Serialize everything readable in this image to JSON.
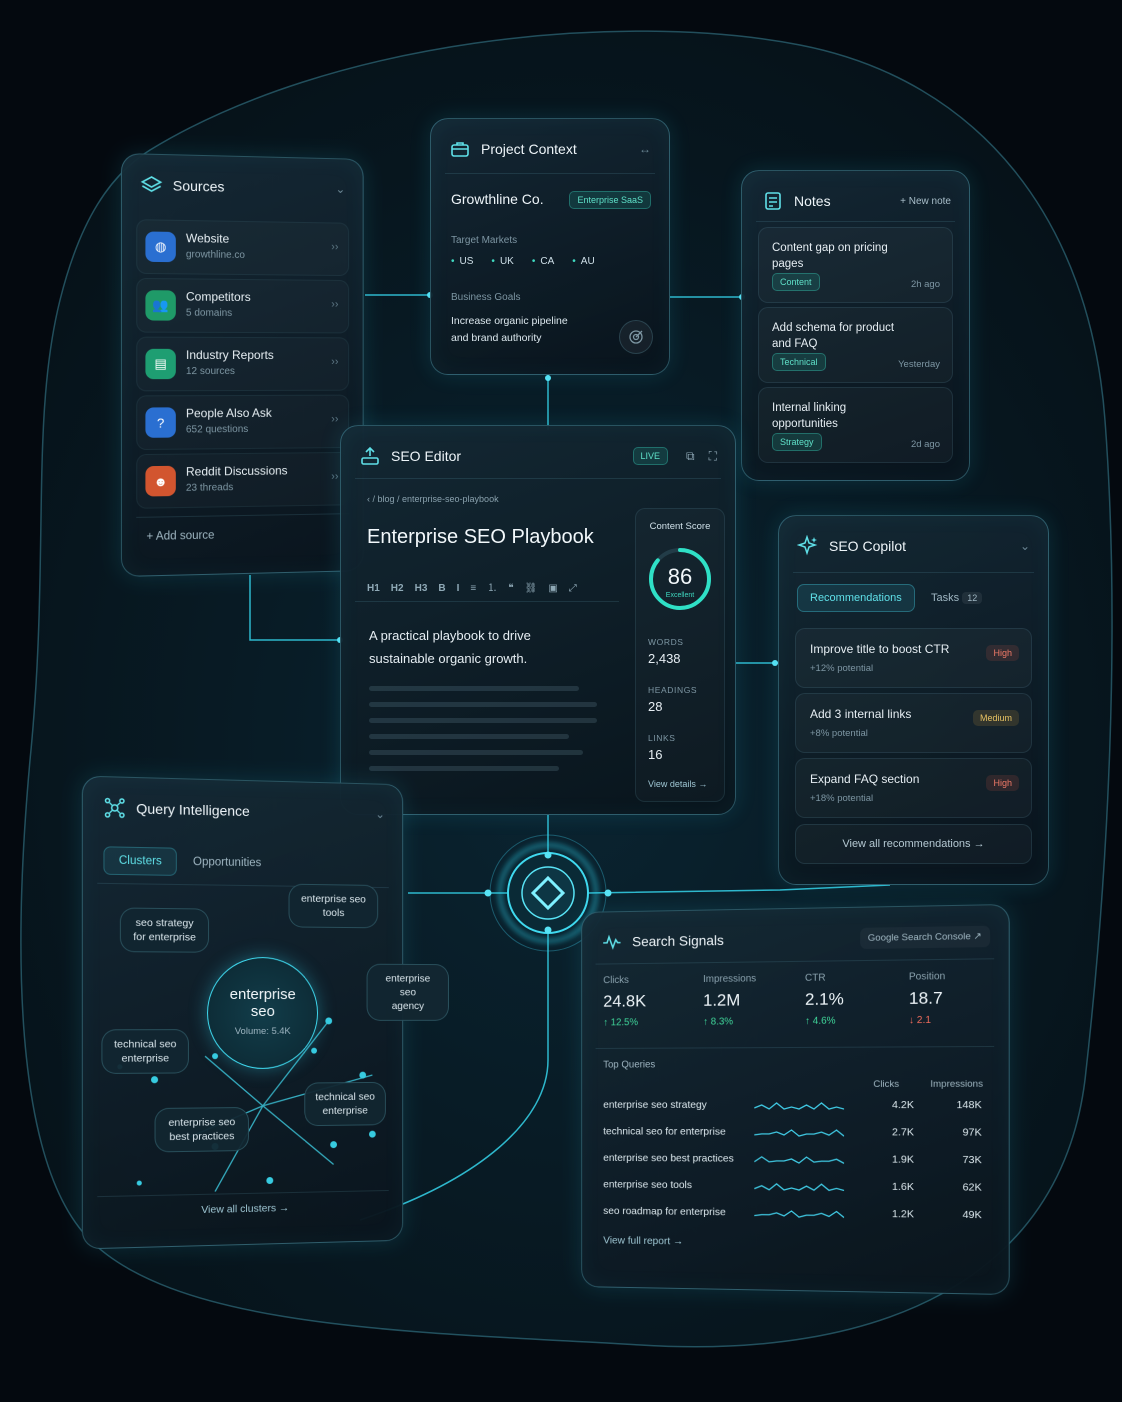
{
  "colors": {
    "accent": "#2fd3ea",
    "bg": "#04090f",
    "up": "#3fd69a",
    "down": "#f06b5c"
  },
  "sources": {
    "title": "Sources",
    "items": [
      {
        "name": "Website",
        "sub": "growthline.co",
        "icon": "globe-icon",
        "color": "#2a6fd1"
      },
      {
        "name": "Competitors",
        "sub": "5 domains",
        "icon": "users-icon",
        "color": "#1f9a68"
      },
      {
        "name": "Industry Reports",
        "sub": "12 sources",
        "icon": "document-icon",
        "color": "#1e9e72"
      },
      {
        "name": "People Also Ask",
        "sub": "652 questions",
        "icon": "question-icon",
        "color": "#2a6fd1"
      },
      {
        "name": "Reddit Discussions",
        "sub": "23 threads",
        "icon": "reddit-icon",
        "color": "#d2552f"
      }
    ],
    "add_label": "Add source"
  },
  "project": {
    "title": "Project Context",
    "company": "Growthline Co.",
    "tag": "Enterprise SaaS",
    "markets_label": "Target Markets",
    "markets": [
      "US",
      "UK",
      "CA",
      "AU"
    ],
    "goals_label": "Business Goals",
    "goals": [
      "Increase organic pipeline",
      "and brand authority"
    ]
  },
  "notes": {
    "title": "Notes",
    "new_label": "New note",
    "items": [
      {
        "text1": "Content gap on pricing",
        "text2": "pages",
        "tag": "Content",
        "time": "2h ago"
      },
      {
        "text1": "Add schema for product",
        "text2": "and FAQ",
        "tag": "Technical",
        "time": "Yesterday"
      },
      {
        "text1": "Internal linking",
        "text2": "opportunities",
        "tag": "Strategy",
        "time": "2d ago"
      }
    ]
  },
  "editor": {
    "title": "SEO Editor",
    "live": "LIVE",
    "breadcrumb": "/ blog / enterprise-seo-playbook",
    "doc_title": "Enterprise SEO Playbook",
    "toolbar": [
      "H1",
      "H2",
      "H3",
      "B",
      "I"
    ],
    "body1": "A practical playbook to drive",
    "body2": "sustainable organic growth.",
    "score_label": "Content Score",
    "score": 86,
    "score_word": "Excellent",
    "words_label": "WORDS",
    "words": "2,438",
    "headings_label": "HEADINGS",
    "headings": "28",
    "links_label": "LINKS",
    "links": "16",
    "details_label": "View details"
  },
  "copilot": {
    "title": "SEO Copilot",
    "tab_active": "Recommendations",
    "tab_other": "Tasks",
    "tasks_count": "12",
    "recs": [
      {
        "title": "Improve title to boost CTR",
        "potential": "+12% potential",
        "priority": "High"
      },
      {
        "title": "Add 3 internal links",
        "potential": "+8% potential",
        "priority": "Medium"
      },
      {
        "title": "Expand FAQ section",
        "potential": "+18% potential",
        "priority": "High"
      }
    ],
    "view_all": "View all recommendations"
  },
  "query": {
    "title": "Query Intelligence",
    "tab_active": "Clusters",
    "tab_other": "Opportunities",
    "center1": "enterprise",
    "center2": "seo",
    "center_sub": "Volume: 5.4K",
    "bubbles": [
      {
        "l1": "seo strategy",
        "l2": "for enterprise"
      },
      {
        "l1": "enterprise seo",
        "l2": "tools"
      },
      {
        "l1": "enterprise seo",
        "l2": "agency"
      },
      {
        "l1": "technical seo",
        "l2": "enterprise"
      },
      {
        "l1": "enterprise seo",
        "l2": "best practices"
      },
      {
        "l1": "technical seo",
        "l2": "enterprise"
      }
    ],
    "view_all": "View all clusters"
  },
  "signals": {
    "title": "Search Signals",
    "source_label": "Google Search Console",
    "metrics": [
      {
        "label": "Clicks",
        "value": "24.8K",
        "delta": "12.5%",
        "dir": "up"
      },
      {
        "label": "Impressions",
        "value": "1.2M",
        "delta": "8.3%",
        "dir": "up"
      },
      {
        "label": "CTR",
        "value": "2.1%",
        "delta": "4.6%",
        "dir": "up"
      },
      {
        "label": "Position",
        "value": "18.7",
        "delta": "2.1",
        "dir": "down"
      }
    ],
    "top_queries_label": "Top Queries",
    "col_clicks": "Clicks",
    "col_impr": "Impressions",
    "queries": [
      {
        "q": "enterprise seo strategy",
        "c": "4.2K",
        "i": "148K"
      },
      {
        "q": "technical seo for enterprise",
        "c": "2.7K",
        "i": "97K"
      },
      {
        "q": "enterprise seo best practices",
        "c": "1.9K",
        "i": "73K"
      },
      {
        "q": "enterprise seo tools",
        "c": "1.6K",
        "i": "62K"
      },
      {
        "q": "seo roadmap for enterprise",
        "c": "1.2K",
        "i": "49K"
      }
    ],
    "view_report": "View full report"
  }
}
